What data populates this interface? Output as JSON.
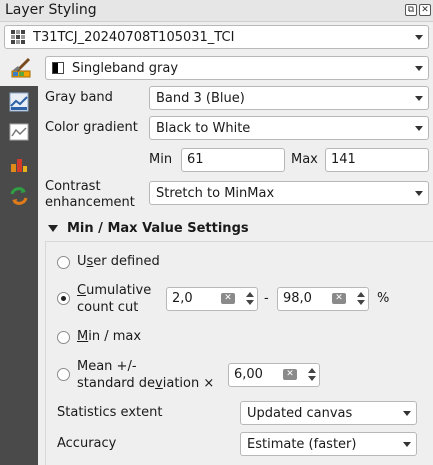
{
  "window": {
    "title": "Layer Styling"
  },
  "layer_select": {
    "value": "T31TCJ_20240708T105031_TCI"
  },
  "renderer": {
    "value": "Singleband gray"
  },
  "fields": {
    "gray_band_label": "Gray band",
    "gray_band_value": "Band 3 (Blue)",
    "color_gradient_label": "Color gradient",
    "color_gradient_value": "Black to White",
    "min_label": "Min",
    "min_value": "61",
    "max_label": "Max",
    "max_value": "141",
    "contrast_label_1": "Contrast",
    "contrast_label_2": "enhancement",
    "contrast_value": "Stretch to MinMax"
  },
  "minmax": {
    "section_title": "Min / Max Value Settings",
    "user_defined_pre": "U",
    "user_defined_ul": "s",
    "user_defined_post": "er defined",
    "cumulative_1_pre": "",
    "cumulative_1_ul": "C",
    "cumulative_1_post": "umulative",
    "cumulative_2": "count cut",
    "cut_low": "2,0",
    "cut_sep": "-",
    "cut_high": "98,0",
    "cut_unit": "%",
    "minmax_ul": "M",
    "minmax_post": "in / max",
    "mean_1": "Mean +/-",
    "mean_2_pre": "standard de",
    "mean_2_ul": "v",
    "mean_2_post": "iation ×",
    "stddev_value": "6,00",
    "stats_extent_label": "Statistics extent",
    "stats_extent_value": "Updated canvas",
    "accuracy_label": "Accuracy",
    "accuracy_value": "Estimate (faster)",
    "selected_option": "cumulative_count_cut"
  },
  "icons": {
    "title_float": "float-icon",
    "title_close": "close-icon",
    "layer": "raster-layer-icon",
    "renderer": "gradient-icon",
    "sidebar": [
      "symbology-icon",
      "transparency-icon",
      "histogram-icon",
      "rendering-icon",
      "history-icon"
    ]
  }
}
